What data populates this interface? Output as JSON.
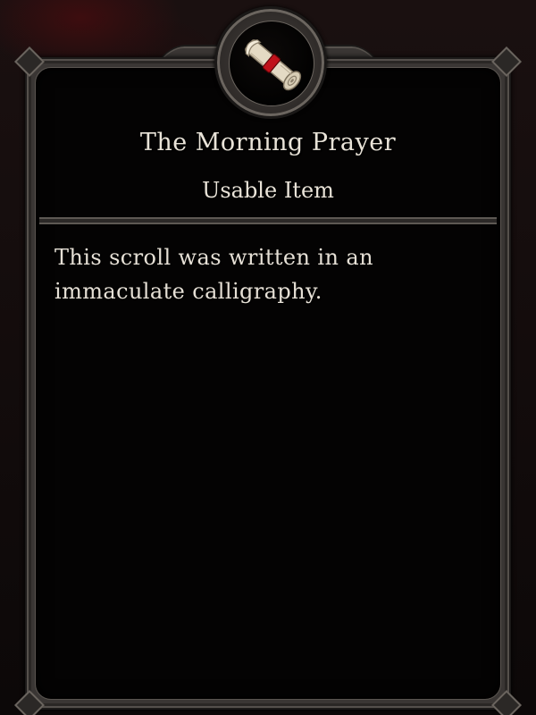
{
  "item": {
    "name": "The Morning Prayer",
    "type": "Usable Item",
    "description": "This scroll was written in an immaculate calligraphy.",
    "icon": "scroll-icon"
  },
  "colors": {
    "text": "#e9e3d8",
    "frame": "#3a3634",
    "panel": "#040303",
    "ribbon": "#c0121b"
  }
}
